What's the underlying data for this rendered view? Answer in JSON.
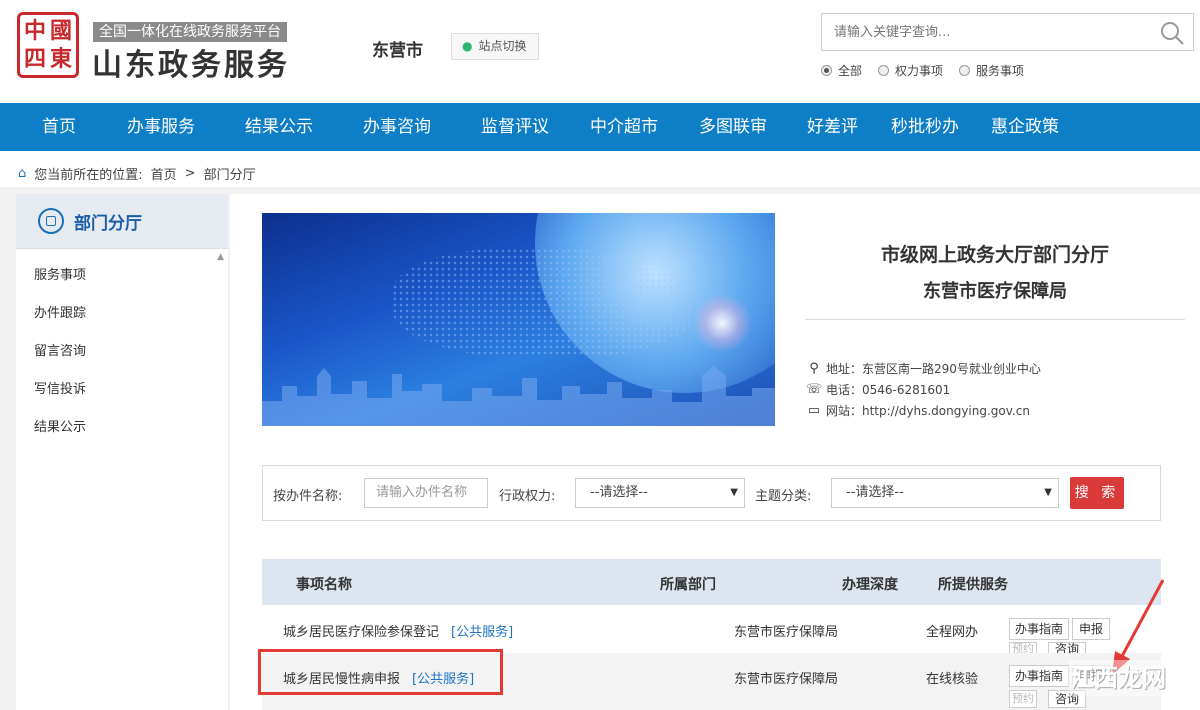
{
  "brand": {
    "seal_text": [
      "中",
      "國",
      "四",
      "東"
    ],
    "subtitle": "全国一体化在线政务服务平台",
    "title": "山东政务服务"
  },
  "header": {
    "city": "东营市",
    "site_switch": "站点切换",
    "search_placeholder": "请输入关键字查询...",
    "radios": [
      {
        "label": "全部",
        "checked": true
      },
      {
        "label": "权力事项",
        "checked": false
      },
      {
        "label": "服务事项",
        "checked": false
      }
    ]
  },
  "nav": [
    "首页",
    "办事服务",
    "结果公示",
    "办事咨询",
    "监督评议",
    "中介超市",
    "多图联审",
    "好差评",
    "秒批秒办",
    "惠企政策"
  ],
  "breadcrumb": {
    "prefix": "您当前所在的位置:",
    "home": "首页",
    "sep": ">",
    "current": "部门分厅"
  },
  "sidebar": {
    "title": "部门分厅",
    "items": [
      "服务事项",
      "办件跟踪",
      "留言咨询",
      "写信投诉",
      "结果公示"
    ]
  },
  "department": {
    "hall": "市级网上政务大厅部门分厅",
    "name": "东营市医疗保障局",
    "address": "地址：东营区南一路290号就业创业中心",
    "phone": "电话：0546-6281601",
    "website": "网站：http://dyhs.dongying.gov.cn"
  },
  "filter": {
    "name_label": "按办件名称:",
    "name_placeholder": "请输入办件名称",
    "power_label": "行政权力:",
    "power_value": "--请选择--",
    "topic_label": "主题分类:",
    "topic_value": "--请选择--",
    "search_button": "搜 索"
  },
  "table": {
    "headers": [
      "事项名称",
      "所属部门",
      "办理深度",
      "所提供服务"
    ],
    "rows": [
      {
        "name": "城乡居民医疗保险参保登记",
        "tag": "[公共服务]",
        "dept": "东营市医疗保障局",
        "depth": "全程网办",
        "buttons": [
          "办事指南",
          "申报",
          "预约",
          "咨询"
        ]
      },
      {
        "name": "城乡居民慢性病申报",
        "tag": "[公共服务]",
        "dept": "东营市医疗保障局",
        "depth": "在线核验",
        "buttons": [
          "办事指南",
          "申报",
          "预约",
          "咨询"
        ]
      }
    ]
  },
  "watermark": "江西龙网",
  "colors": {
    "nav_bg": "#0e7fc6",
    "search_button": "#d93b3b",
    "link_tag": "#1e73c2",
    "highlight": "#e53935"
  }
}
